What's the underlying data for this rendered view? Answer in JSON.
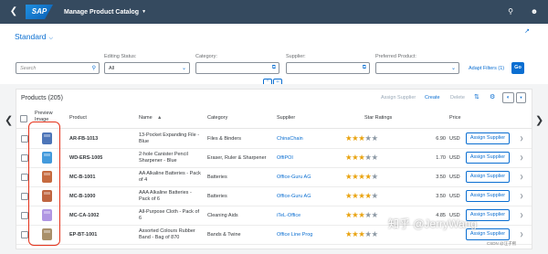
{
  "shell": {
    "logo": "SAP",
    "title": "Manage Product Catalog"
  },
  "header": {
    "variant": "Standard",
    "filters": {
      "search_placeholder": "Search",
      "editing_status_label": "Editing Status:",
      "editing_status_value": "All",
      "category_label": "Category:",
      "supplier_label": "Supplier:",
      "preferred_product_label": "Preferred Product:",
      "adapt_label": "Adapt Filters (1)",
      "go_label": "Go"
    }
  },
  "table": {
    "title": "Products (205)",
    "toolbar": {
      "assign_supplier": "Assign Supplier",
      "create": "Create",
      "delete": "Delete"
    },
    "columns": {
      "preview_line1": "Preview",
      "preview_line2": "Image",
      "product": "Product",
      "name": "Name",
      "category": "Category",
      "supplier": "Supplier",
      "ratings": "Star Ratings",
      "price": "Price"
    },
    "rows": [
      {
        "product": "AR-FB-1013",
        "name1": "13-Pocket Expanding File -",
        "name2": "Blue",
        "category": "Files & Binders",
        "supplier": "ChinaChain",
        "rating": 3,
        "price": "6.90",
        "currency": "USD",
        "action": "Assign Supplier",
        "thumb_color": "#3a66b0"
      },
      {
        "product": "WD-ERS-1005",
        "name1": "2-hole Canister Pencil",
        "name2": "Sharpener - Blue",
        "category": "Eraser, Ruler & Sharpener",
        "supplier": "OffiPOI",
        "rating": 3,
        "price": "1.70",
        "currency": "USD",
        "action": "Assign Supplier",
        "thumb_color": "#2f8fd8"
      },
      {
        "product": "MC-B-1001",
        "name1": "AA Alkaline Batteries - Pack",
        "name2": "of 4",
        "category": "Batteries",
        "supplier": "Office-Guru AG",
        "rating": 4,
        "price": "3.50",
        "currency": "USD",
        "action": "Assign Supplier",
        "thumb_color": "#c05a2a"
      },
      {
        "product": "MC-B-1000",
        "name1": "AAA Alkaline Batteries -",
        "name2": "Pack of 6",
        "category": "Batteries",
        "supplier": "Office-Guru AG",
        "rating": 4,
        "price": "3.50",
        "currency": "USD",
        "action": "Assign Supplier",
        "thumb_color": "#b8542b"
      },
      {
        "product": "MC-CA-1002",
        "name1": "All-Purpose Cloth - Pack of",
        "name2": "6",
        "category": "Cleaning Aids",
        "supplier": "iTeL-Office",
        "rating": 3,
        "price": "4.85",
        "currency": "USD",
        "action": "Assign Supplier",
        "thumb_color": "#a78be0"
      },
      {
        "product": "EP-BT-1001",
        "name1": "Assorted Colours Rubber",
        "name2": "Band - Bag of 870",
        "category": "Bands & Twine",
        "supplier": "Office Line Prog",
        "rating": 3,
        "price": "",
        "currency": "",
        "action": "Assign Supplier",
        "thumb_color": "#a0845a"
      }
    ]
  },
  "watermark": {
    "text": "知乎 @JerryWang",
    "sub": "CSDN @汪子熙"
  }
}
